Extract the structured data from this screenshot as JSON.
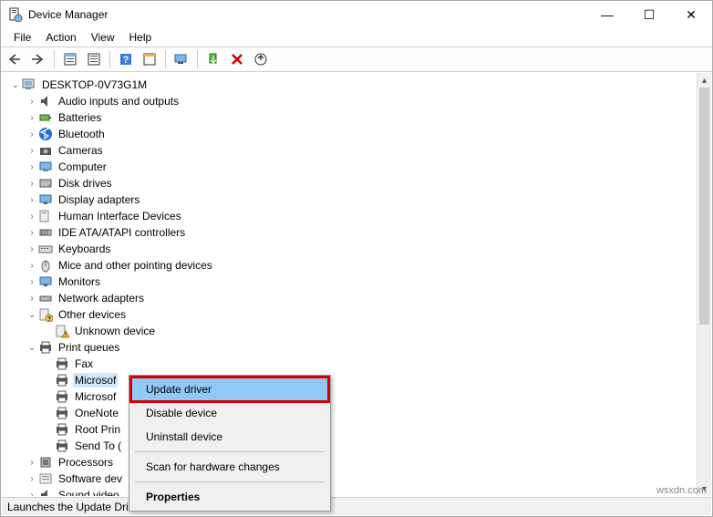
{
  "window": {
    "title": "Device Manager",
    "minimize": "—",
    "maximize": "☐",
    "close": "✕"
  },
  "menu": {
    "file": "File",
    "action": "Action",
    "view": "View",
    "help": "Help"
  },
  "root": {
    "name": "DESKTOP-0V73G1M"
  },
  "categories": [
    {
      "key": "audio",
      "label": "Audio inputs and outputs"
    },
    {
      "key": "batt",
      "label": "Batteries"
    },
    {
      "key": "bt",
      "label": "Bluetooth"
    },
    {
      "key": "cam",
      "label": "Cameras"
    },
    {
      "key": "comp",
      "label": "Computer"
    },
    {
      "key": "disk",
      "label": "Disk drives"
    },
    {
      "key": "disp",
      "label": "Display adapters"
    },
    {
      "key": "hid",
      "label": "Human Interface Devices"
    },
    {
      "key": "ide",
      "label": "IDE ATA/ATAPI controllers"
    },
    {
      "key": "kb",
      "label": "Keyboards"
    },
    {
      "key": "mice",
      "label": "Mice and other pointing devices"
    },
    {
      "key": "mon",
      "label": "Monitors"
    },
    {
      "key": "net",
      "label": "Network adapters"
    }
  ],
  "other_devices": {
    "label": "Other devices",
    "children": [
      {
        "label": "Unknown device"
      }
    ]
  },
  "print_queues": {
    "label": "Print queues",
    "children": [
      {
        "label": "Fax"
      },
      {
        "label": "Microsof",
        "selected": true
      },
      {
        "label": "Microsof"
      },
      {
        "label": "OneNote"
      },
      {
        "label": "Root Prin"
      },
      {
        "label": "Send To ("
      }
    ]
  },
  "more": [
    {
      "label": "Processors"
    },
    {
      "label": "Software dev"
    },
    {
      "label": "Sound  video"
    }
  ],
  "context_menu": {
    "update": "Update driver",
    "disable": "Disable device",
    "uninstall": "Uninstall device",
    "scan": "Scan for hardware changes",
    "props": "Properties"
  },
  "statusbar": "Launches the Update Driver Wizard for the selected device.",
  "watermark": "wsxdn.com"
}
